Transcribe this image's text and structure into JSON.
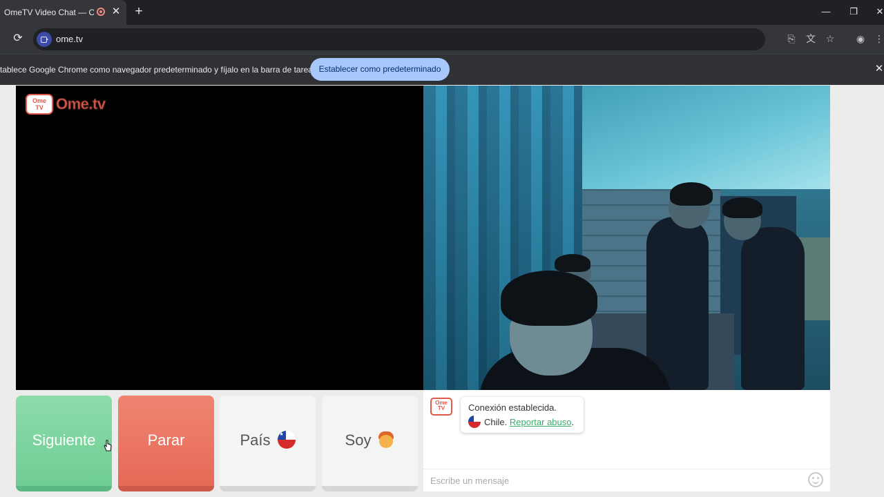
{
  "browser": {
    "tab_title": "OmeTV Video Chat — Ome",
    "tab_close": "✕",
    "new_tab": "+",
    "url": "ome.tv",
    "window_controls": {
      "minimize": "—",
      "restore": "❐",
      "close": "✕"
    }
  },
  "infobar": {
    "message": "tablece Google Chrome como navegador predeterminado y fíjalo en la barra de tareas",
    "button": "Establecer como predeterminado",
    "close": "✕"
  },
  "logo": {
    "tv_text": "Ome TV",
    "wordmark": "Ome.tv"
  },
  "controls": {
    "next": "Siguiente",
    "stop": "Parar",
    "country": "País",
    "gender": "Soy"
  },
  "chat": {
    "logo_text": "Ome TV",
    "status": "Conexión establecida.",
    "country": "Chile.",
    "report_link": "Reportar abuso",
    "report_suffix": ".",
    "input_placeholder": "Escribe un mensaje"
  },
  "icons": {
    "reload": "reload-icon",
    "install": "install-app-icon",
    "translate": "translate-icon",
    "bookmark": "star-icon",
    "profile": "profile-icon",
    "menu": "menu-icon",
    "emoji": "emoji-icon",
    "flag": "chile-flag-icon"
  },
  "colors": {
    "next": "#7dd5a0",
    "stop": "#ea755f",
    "brand": "#e2584a",
    "link": "#3bab6b",
    "infobar_button": "#a8c7fa"
  }
}
